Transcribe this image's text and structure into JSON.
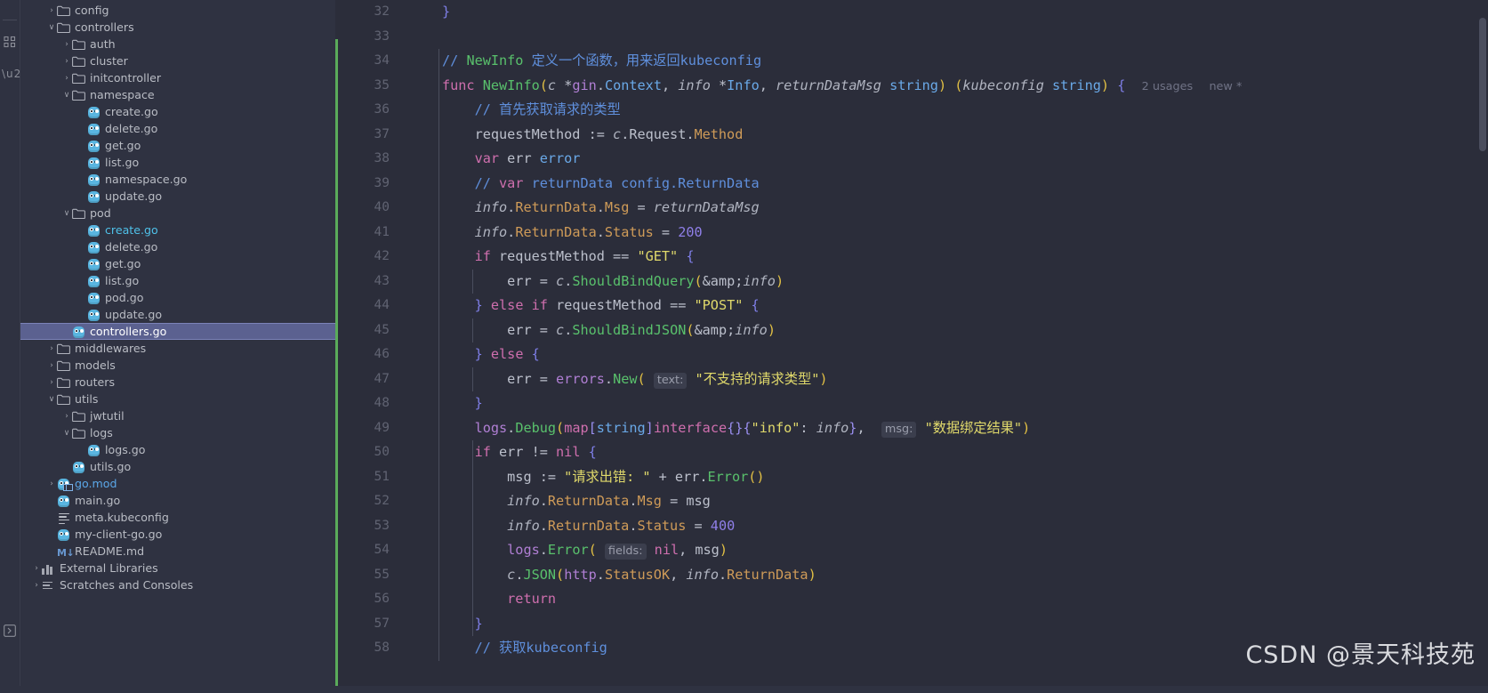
{
  "toolwindow": {
    "structure_icon": "structure-icon",
    "more_icon": "more-options-icon",
    "expand_icon": "expand-tool-window-icon"
  },
  "tree": {
    "items": [
      {
        "indent": 1,
        "chevron": "›",
        "icon": "folder-icon",
        "label": "config",
        "color": ""
      },
      {
        "indent": 1,
        "chevron": "∨",
        "icon": "folder-icon",
        "label": "controllers",
        "color": ""
      },
      {
        "indent": 2,
        "chevron": "›",
        "icon": "folder-icon",
        "label": "auth",
        "color": ""
      },
      {
        "indent": 2,
        "chevron": "›",
        "icon": "folder-icon",
        "label": "cluster",
        "color": ""
      },
      {
        "indent": 2,
        "chevron": "›",
        "icon": "folder-icon",
        "label": "initcontroller",
        "color": ""
      },
      {
        "indent": 2,
        "chevron": "∨",
        "icon": "folder-icon",
        "label": "namespace",
        "color": ""
      },
      {
        "indent": 3,
        "chevron": "",
        "icon": "go-file-icon",
        "label": "create.go",
        "color": ""
      },
      {
        "indent": 3,
        "chevron": "",
        "icon": "go-file-icon",
        "label": "delete.go",
        "color": ""
      },
      {
        "indent": 3,
        "chevron": "",
        "icon": "go-file-icon",
        "label": "get.go",
        "color": ""
      },
      {
        "indent": 3,
        "chevron": "",
        "icon": "go-file-icon",
        "label": "list.go",
        "color": ""
      },
      {
        "indent": 3,
        "chevron": "",
        "icon": "go-file-icon",
        "label": "namespace.go",
        "color": ""
      },
      {
        "indent": 3,
        "chevron": "",
        "icon": "go-file-icon",
        "label": "update.go",
        "color": ""
      },
      {
        "indent": 2,
        "chevron": "∨",
        "icon": "folder-icon",
        "label": "pod",
        "color": ""
      },
      {
        "indent": 3,
        "chevron": "",
        "icon": "go-file-icon",
        "label": "create.go",
        "color": "cyan"
      },
      {
        "indent": 3,
        "chevron": "",
        "icon": "go-file-icon",
        "label": "delete.go",
        "color": ""
      },
      {
        "indent": 3,
        "chevron": "",
        "icon": "go-file-icon",
        "label": "get.go",
        "color": ""
      },
      {
        "indent": 3,
        "chevron": "",
        "icon": "go-file-icon",
        "label": "list.go",
        "color": ""
      },
      {
        "indent": 3,
        "chevron": "",
        "icon": "go-file-icon",
        "label": "pod.go",
        "color": ""
      },
      {
        "indent": 3,
        "chevron": "",
        "icon": "go-file-icon",
        "label": "update.go",
        "color": ""
      },
      {
        "indent": 2,
        "chevron": "",
        "icon": "go-file-icon",
        "label": "controllers.go",
        "color": "",
        "selected": true
      },
      {
        "indent": 1,
        "chevron": "›",
        "icon": "folder-icon",
        "label": "middlewares",
        "color": ""
      },
      {
        "indent": 1,
        "chevron": "›",
        "icon": "folder-icon",
        "label": "models",
        "color": ""
      },
      {
        "indent": 1,
        "chevron": "›",
        "icon": "folder-icon",
        "label": "routers",
        "color": ""
      },
      {
        "indent": 1,
        "chevron": "∨",
        "icon": "folder-icon",
        "label": "utils",
        "color": ""
      },
      {
        "indent": 2,
        "chevron": "›",
        "icon": "folder-icon",
        "label": "jwtutil",
        "color": ""
      },
      {
        "indent": 2,
        "chevron": "∨",
        "icon": "folder-icon",
        "label": "logs",
        "color": ""
      },
      {
        "indent": 3,
        "chevron": "",
        "icon": "go-file-icon",
        "label": "logs.go",
        "color": ""
      },
      {
        "indent": 2,
        "chevron": "",
        "icon": "go-file-icon",
        "label": "utils.go",
        "color": ""
      },
      {
        "indent": 1,
        "chevron": "›",
        "icon": "go-mod-icon",
        "label": "go.mod",
        "color": "blue"
      },
      {
        "indent": 1,
        "chevron": "",
        "icon": "go-file-icon",
        "label": "main.go",
        "color": ""
      },
      {
        "indent": 1,
        "chevron": "",
        "icon": "kubeconfig-file-icon",
        "label": "meta.kubeconfig",
        "color": ""
      },
      {
        "indent": 1,
        "chevron": "",
        "icon": "go-file-icon",
        "label": "my-client-go.go",
        "color": ""
      },
      {
        "indent": 1,
        "chevron": "",
        "icon": "markdown-file-icon",
        "label": "README.md",
        "color": ""
      },
      {
        "indent": 0,
        "chevron": "›",
        "icon": "external-libraries-icon",
        "label": "External Libraries",
        "color": ""
      },
      {
        "indent": 0,
        "chevron": "›",
        "icon": "scratches-icon",
        "label": "Scratches and Consoles",
        "color": ""
      }
    ]
  },
  "editor": {
    "first_line": 32,
    "last_line": 58,
    "line_numbers": [
      32,
      33,
      34,
      35,
      36,
      37,
      38,
      39,
      40,
      41,
      42,
      43,
      44,
      45,
      46,
      47,
      48,
      49,
      50,
      51,
      52,
      53,
      54,
      55,
      56,
      57,
      58
    ],
    "inlay_usages": "2 usages",
    "inlay_new": "new *",
    "hint_text": "text:",
    "hint_msg": "msg:",
    "hint_fields": "fields:",
    "lines": {
      "l32": "}",
      "l33": "",
      "l34_comment_slashes": "// ",
      "l34_ident": "NewInfo",
      "l34_rest": " 定义一个函数，用来返回kubeconfig",
      "l35_kw": "func",
      "l35_name": "NewInfo",
      "l35_sig_a": "c",
      "l35_sig_b": "*gin",
      "l35_sig_c": ".Context, ",
      "l35_sig_d": "info",
      "l35_sig_e": " *Info, ",
      "l35_sig_f": "returnDataMsg",
      "l35_sig_g": " string",
      "l35_sig_h": "kubeconfig",
      "l35_sig_i": " string",
      "l36": "// 首先获取请求的类型",
      "l37_a": "requestMethod := ",
      "l37_b": "c",
      "l37_c": ".Request.",
      "l37_d": "Method",
      "l38_kw": "var",
      "l38_rest": " err error",
      "l39": "// var returnData config.ReturnData",
      "l40_a": "info",
      "l40_b": ".ReturnData.Msg",
      "l40_c": " = ",
      "l40_d": "returnDataMsg",
      "l41_a": "info",
      "l41_b": ".ReturnData.Status",
      "l41_c": " = ",
      "l41_d": "200",
      "l42_kw": "if",
      "l42_mid": " requestMethod == ",
      "l42_str": "\"GET\"",
      "l42_brace": " {",
      "l43_a": "err = ",
      "l43_b": "c",
      "l43_c": ".",
      "l43_d": "ShouldBindQuery",
      "l43_e": "(",
      "l43_f": "&info",
      "l43_g": ")",
      "l44_a": "} ",
      "l44_kw1": "else",
      "l44_kw2": "if",
      "l44_mid": " requestMethod == ",
      "l44_str": "\"POST\"",
      "l44_brace": " {",
      "l45_a": "err = ",
      "l45_b": "c",
      "l45_c": ".",
      "l45_d": "ShouldBindJSON",
      "l45_e": "(",
      "l45_f": "&info",
      "l45_g": ")",
      "l46_a": "} ",
      "l46_kw": "else",
      "l46_brace": " {",
      "l47_a": "err = ",
      "l47_b": "errors",
      "l47_c": ".",
      "l47_d": "New",
      "l47_e": "(",
      "l47_str": "\"不支持的请求类型\"",
      "l47_f": ")",
      "l48": "}",
      "l49_a": "logs",
      "l49_b": ".",
      "l49_c": "Debug",
      "l49_d": "(",
      "l49_e": "map",
      "l49_f": "[",
      "l49_g": "string",
      "l49_h": "]",
      "l49_i": "interface",
      "l49_j": "{}{",
      "l49_k": "\"info\"",
      "l49_l": ": ",
      "l49_m": "info",
      "l49_n": "}, ",
      "l49_str": "\"数据绑定结果\"",
      "l49_o": ")",
      "l50_kw": "if",
      "l50_rest": " err != ",
      "l50_nil": "nil",
      "l50_brace": " {",
      "l51_a": "msg := ",
      "l51_str": "\"请求出错: \"",
      "l51_b": " + err.",
      "l51_c": "Error",
      "l51_d": "()",
      "l52_a": "info",
      "l52_b": ".ReturnData.Msg",
      "l52_c": " = msg",
      "l53_a": "info",
      "l53_b": ".ReturnData.Status",
      "l53_c": " = ",
      "l53_d": "400",
      "l54_a": "logs",
      "l54_b": ".",
      "l54_c": "Error",
      "l54_d": "(",
      "l54_e": "nil",
      "l54_f": ", msg",
      "l54_g": ")",
      "l55_a": "c",
      "l55_b": ".",
      "l55_c": "JSON",
      "l55_d": "(",
      "l55_e": "http",
      "l55_f": ".",
      "l55_g": "StatusOK",
      "l55_h": ", ",
      "l55_i": "info",
      "l55_j": ".ReturnData",
      "l55_k": ")",
      "l56": "return",
      "l57": "}",
      "l58_slashes": "// ",
      "l58_rest": "获取kubeconfig"
    }
  },
  "watermark": {
    "text": "CSDN @景天科技苑"
  },
  "colors": {
    "selection": "#5b6190",
    "vcs_added": "#5aab5a",
    "accent_cyan": "#4fc1e9",
    "editor_bg": "#2b2d3a",
    "panel_bg": "#2f3241"
  }
}
